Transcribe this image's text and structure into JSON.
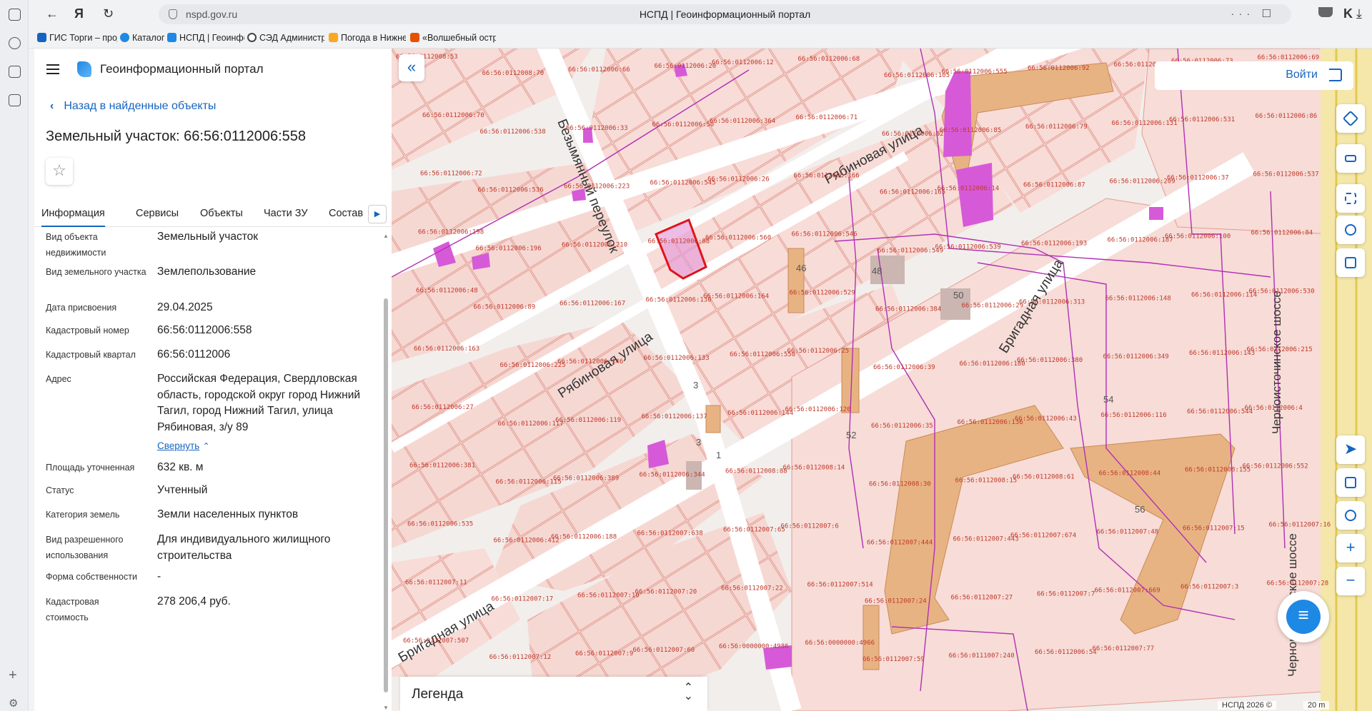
{
  "browser": {
    "url": "nspd.gov.ru",
    "page_title": "НСПД | Геоинформационный портал",
    "bookmarks": [
      {
        "label": "ГИС Торги – прод",
        "color": "#1565c0"
      },
      {
        "label": "Каталог",
        "color": "#1e88e5"
      },
      {
        "label": "НСПД | Геоинфор",
        "color": "#1e88e5"
      },
      {
        "label": "СЭД Администра",
        "color": "#444444"
      },
      {
        "label": "Погода в Нижнем",
        "color": "#f9a825"
      },
      {
        "label": "«Волшебный остр",
        "color": "#e65100"
      }
    ]
  },
  "panel": {
    "portal_name": "Геоинформационный портал",
    "back_link": "Назад в найденные объекты",
    "object_title": "Земельный участок: 66:56:0112006:558",
    "tabs": [
      "Информация",
      "Сервисы",
      "Объекты",
      "Части ЗУ",
      "Состав"
    ],
    "properties": [
      {
        "label": "Вид объекта недвижимости",
        "value": "Земельный участок"
      },
      {
        "label": "Вид земельного участка",
        "value": "Землепользование"
      },
      {
        "label": "Дата присвоения",
        "value": "29.04.2025"
      },
      {
        "label": "Кадастровый номер",
        "value": "66:56:0112006:558"
      },
      {
        "label": "Кадастровый квартал",
        "value": "66:56:0112006"
      },
      {
        "label": "Адрес",
        "value": "Российская Федерация, Свердловская область, городской округ город Нижний Тагил, город Нижний Тагил, улица Рябиновая, з/у 89"
      },
      {
        "label": "Площадь уточненная",
        "value": "632 кв. м"
      },
      {
        "label": "Статус",
        "value": "Учтенный"
      },
      {
        "label": "Категория земель",
        "value": "Земли населенных пунктов"
      },
      {
        "label": "Вид разрешенного использования",
        "value": "Для индивидуального жилищного строительства"
      },
      {
        "label": "Форма собственности",
        "value": "-"
      },
      {
        "label": "Кадастровая стоимость",
        "value": "278 206,4 руб."
      }
    ],
    "collapse_label": "Свернуть"
  },
  "map": {
    "login_label": "Войти",
    "legend_label": "Легенда",
    "copyright": "НСПД 2026 ©",
    "scale": "20 m",
    "streets": [
      "Безымянный переулок",
      "Рябиновая улица",
      "Рябиновая улица",
      "Бригадная улица",
      "Бригадная улица",
      "Черноисточинское шоссе",
      "Черноисточинское шоссе"
    ],
    "parcel_labels": [
      "66:56:0112008:53",
      "66:56:0112008:70",
      "66:56:0112006:66",
      "66:56:0112006:20",
      "66:56:0112006:12",
      "66:56:0112006:68",
      "66:56:0112006:105",
      "66:56:0112006:555",
      "66:56:0112006:92",
      "66:56:0112006:553",
      "66:56:0112006:73",
      "66:56:0112006:69",
      "66:56:0112006:70",
      "66:56:0112006:538",
      "66:56:0112006:33",
      "66:56:0112006:50",
      "66:56:0112006:364",
      "66:56:0112006:71",
      "66:56:0112006:62",
      "66:56:0112006:85",
      "66:56:0112006:79",
      "66:56:0112006:131",
      "66:56:0112006:531",
      "66:56:0112006:86",
      "66:56:0112006:72",
      "66:56:0112006:536",
      "66:56:0112006:223",
      "66:56:0112006:545",
      "66:56:0112006:26",
      "66:56:0112006:166",
      "66:56:0112006:165",
      "66:56:0112006:14",
      "66:56:0112006:87",
      "66:56:0112006:209",
      "66:56:0112006:37",
      "66:56:0112006:537",
      "66:56:0112006:198",
      "66:56:0112006:196",
      "66:56:0112006:210",
      "66:56:0112006:88",
      "66:56:0112006:560",
      "66:56:0112006:546",
      "66:56:0112006:549",
      "66:56:0112006:539",
      "66:56:0112006:193",
      "66:56:0112006:187",
      "66:56:0112006:100",
      "66:56:0112006:84",
      "66:56:0112006:48",
      "66:56:0112006:89",
      "66:56:0112006:167",
      "66:56:0112006:130",
      "66:56:0112006:164",
      "66:56:0112006:529",
      "66:56:0112006:384",
      "66:56:0112006:29",
      "66:56:0112006:313",
      "66:56:0112006:148",
      "66:56:0112006:114",
      "66:56:0112006:530",
      "66:56:0112006:163",
      "66:56:0112006:225",
      "66:56:0112006:146",
      "66:56:0112006:133",
      "66:56:0112006:550",
      "66:56:0112006:25",
      "66:56:0112006:39",
      "66:56:0112006:180",
      "66:56:0112006:380",
      "66:56:0112006:349",
      "66:56:0112006:143",
      "66:56:0112006:215",
      "66:56:0112006:27",
      "66:56:0112006:117",
      "66:56:0112006:119",
      "66:56:0112006:137",
      "66:56:0112006:144",
      "66:56:0112006:120",
      "66:56:0112006:35",
      "66:56:0112006:136",
      "66:56:0112006:43",
      "66:56:0112006:116",
      "66:56:0112006:544",
      "66:56:0112006:4",
      "66:56:0112006:381",
      "66:56:0112006:115",
      "66:56:0112006:389",
      "66:56:0112006:344",
      "66:56:0112008:88",
      "66:56:0112008:14",
      "66:56:0112008:30",
      "66:56:0112008:15",
      "66:56:0112008:61",
      "66:56:0112008:44",
      "66:56:0112008:155",
      "66:56:0112006:552",
      "66:56:0112006:535",
      "66:56:0112006:412",
      "66:56:0112006:188",
      "66:56:0112007:638",
      "66:56:0112007:65",
      "66:56:0112007:6",
      "66:56:0112007:444",
      "66:56:0112007:443",
      "66:56:0112007:674",
      "66:56:0112007:48",
      "66:56:0112007:15",
      "66:56:0112007:16",
      "66:56:0112007:11",
      "66:56:0112007:17",
      "66:56:0112007:10",
      "66:56:0112007:20",
      "66:56:0112007:22",
      "66:56:0112007:514",
      "66:56:0112007:24",
      "66:56:0112007:27",
      "66:56:0112007:7",
      "66:56:0112007:669",
      "66:56:0112007:3",
      "66:56:0112007:28",
      "66:56:0112007:507",
      "66:56:0112007:12",
      "66:56:0112007:9",
      "66:56:0112007:60",
      "66:56:0000000:4986",
      "66:56:0000000:4966",
      "66:56:0112007:59",
      "66:56:0111007:240",
      "66:56:0112006:54",
      "66:56:0112007:77"
    ],
    "house_numbers": [
      "46",
      "48",
      "50",
      "3",
      "3",
      "1",
      "52",
      "54",
      "56"
    ]
  }
}
